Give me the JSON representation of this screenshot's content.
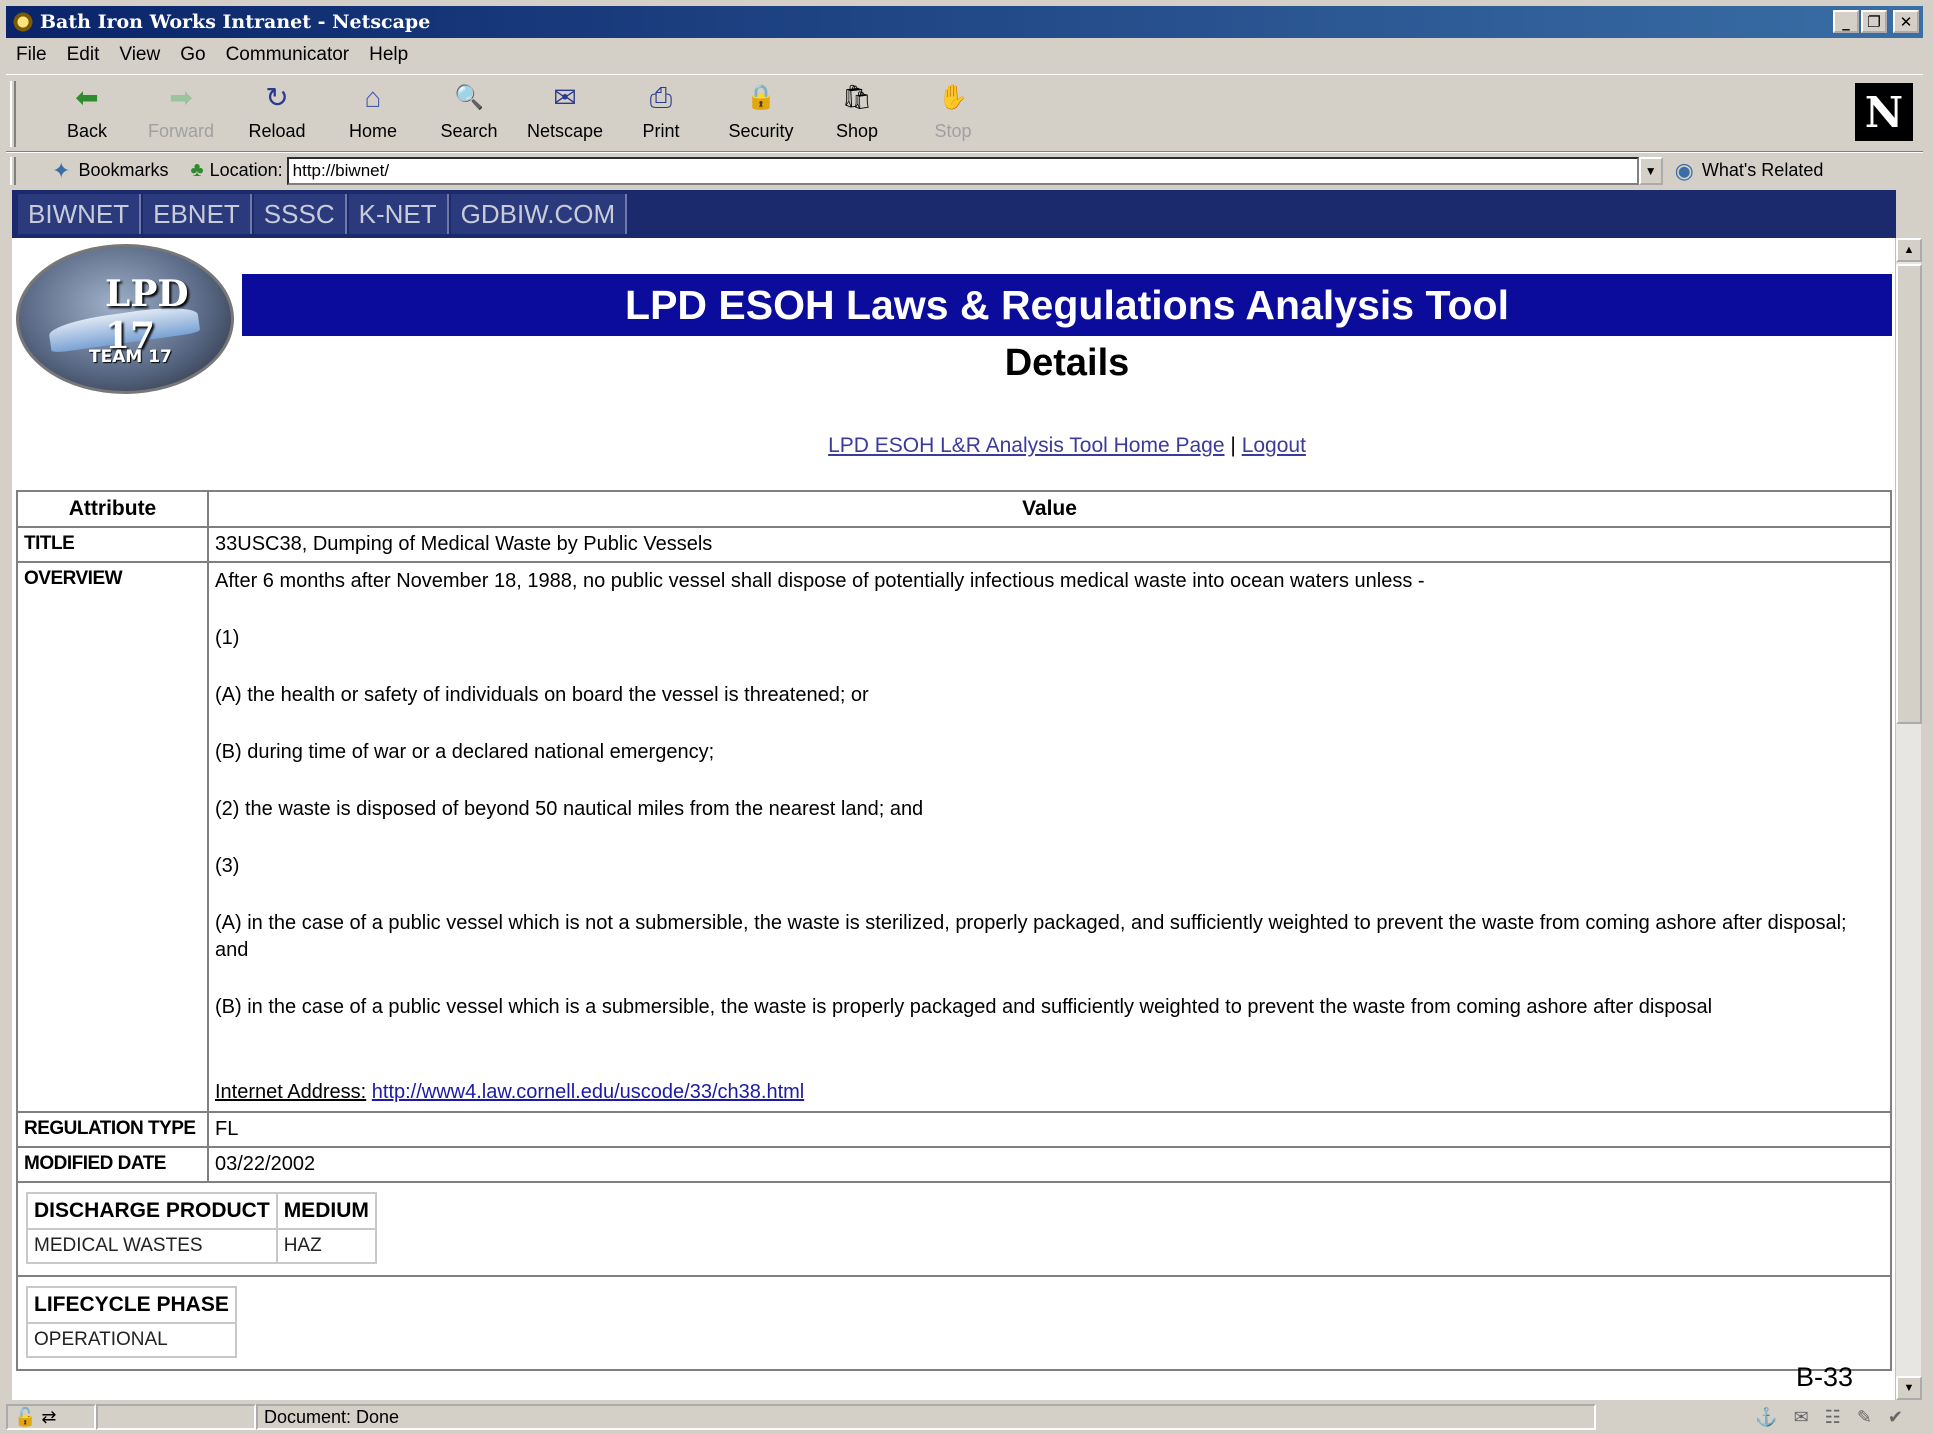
{
  "window": {
    "title": "Bath Iron Works Intranet - Netscape",
    "buttons": {
      "minimize": "_",
      "maximize": "❐",
      "close": "✕"
    }
  },
  "menu": [
    "File",
    "Edit",
    "View",
    "Go",
    "Communicator",
    "Help"
  ],
  "toolbar": {
    "buttons": [
      {
        "label": "Back",
        "icon": "back-arrow-icon",
        "glyph": "⬅",
        "enabled": true
      },
      {
        "label": "Forward",
        "icon": "forward-arrow-icon",
        "glyph": "➡",
        "enabled": false
      },
      {
        "label": "Reload",
        "icon": "reload-icon",
        "glyph": "↻",
        "enabled": true
      },
      {
        "label": "Home",
        "icon": "home-icon",
        "glyph": "⌂",
        "enabled": true
      },
      {
        "label": "Search",
        "icon": "search-icon",
        "glyph": "🔍",
        "enabled": true
      },
      {
        "label": "Netscape",
        "icon": "netscape-icon",
        "glyph": "✉",
        "enabled": true
      },
      {
        "label": "Print",
        "icon": "print-icon",
        "glyph": "⎙",
        "enabled": true
      },
      {
        "label": "Security",
        "icon": "lock-icon",
        "glyph": "🔒",
        "enabled": true
      },
      {
        "label": "Shop",
        "icon": "shop-icon",
        "glyph": "🛍",
        "enabled": true
      },
      {
        "label": "Stop",
        "icon": "stop-icon",
        "glyph": "✋",
        "enabled": false
      }
    ],
    "logo_letter": "N"
  },
  "locationbar": {
    "bookmarks_label": "Bookmarks",
    "location_label": "Location:",
    "url": "http://biwnet/",
    "whats_related": "What's Related"
  },
  "intranet_nav": [
    "BIWNET",
    "EBNET",
    "SSSC",
    "K-NET",
    "GDBIW.COM"
  ],
  "logo": {
    "line1": "LPD 17",
    "line2": "TEAM 17"
  },
  "page": {
    "banner": "LPD ESOH Laws & Regulations Analysis Tool",
    "subtitle": "Details",
    "home_link": "LPD ESOH L&R Analysis Tool Home Page",
    "separator": "|",
    "logout_link": "Logout"
  },
  "table": {
    "headers": {
      "attribute": "Attribute",
      "value": "Value"
    },
    "title": {
      "label": "TITLE",
      "value": "33USC38, Dumping of Medical Waste by Public Vessels"
    },
    "overview": {
      "label": "OVERVIEW",
      "paragraphs": [
        "After 6 months after November 18, 1988, no public vessel shall dispose of potentially infectious medical waste into ocean waters unless -",
        "(1)",
        "(A) the health or safety of individuals on board the vessel is threatened; or",
        "(B) during time of war or a declared national emergency;",
        "(2) the waste is disposed of beyond 50 nautical miles from the nearest land; and",
        "(3)",
        "(A) in the case of a public vessel which is not a submersible, the waste is sterilized, properly packaged, and sufficiently weighted to prevent the waste from coming ashore after disposal; and",
        "(B) in the case of a public vessel which is a submersible, the waste is properly packaged and sufficiently weighted to prevent the waste from coming ashore after disposal"
      ],
      "internet_label": "Internet Address:",
      "internet_url": "http://www4.law.cornell.edu/uscode/33/ch38.html"
    },
    "regulation_type": {
      "label": "REGULATION TYPE",
      "value": "FL"
    },
    "modified_date": {
      "label": "MODIFIED DATE",
      "value": "03/22/2002"
    },
    "discharge": {
      "headers": [
        "DISCHARGE PRODUCT",
        "MEDIUM"
      ],
      "values": [
        "MEDICAL WASTES",
        "HAZ"
      ]
    },
    "lifecycle": {
      "header": "LIFECYCLE PHASE",
      "value": "OPERATIONAL"
    }
  },
  "page_number": "B-33",
  "status": {
    "text": "Document: Done"
  }
}
